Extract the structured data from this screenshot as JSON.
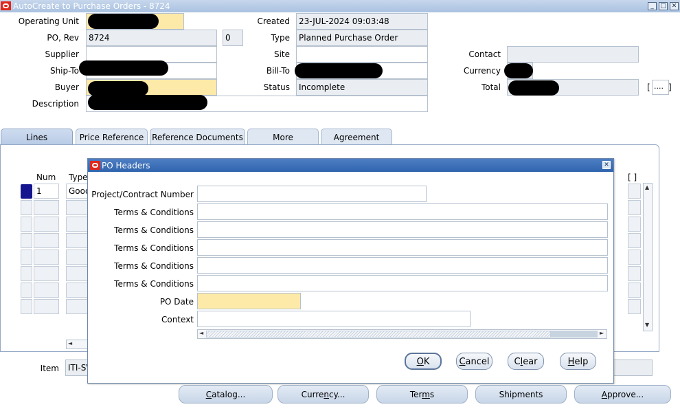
{
  "window": {
    "title": "AutoCreate to Purchase Orders - 8724",
    "minimize": "_",
    "maximize": "□",
    "close": "✕"
  },
  "header": {
    "operating_unit_label": "Operating Unit",
    "po_rev_label": "PO, Rev",
    "po_number": "8724",
    "revision": "0",
    "supplier_label": "Supplier",
    "ship_to_label": "Ship-To",
    "buyer_label": "Buyer",
    "description_label": "Description",
    "created_label": "Created",
    "created_value": "23-JUL-2024 09:03:48",
    "type_label": "Type",
    "type_value": "Planned Purchase Order",
    "site_label": "Site",
    "bill_to_label": "Bill-To",
    "status_label": "Status",
    "status_value": "Incomplete",
    "contact_label": "Contact",
    "currency_label": "Currency",
    "total_label": "Total",
    "flex_open": "[",
    "flex_dots": "....",
    "flex_close": "]"
  },
  "tabs": [
    {
      "label": "Lines"
    },
    {
      "label": "Price Reference"
    },
    {
      "label": "Reference Documents"
    },
    {
      "label": "More"
    },
    {
      "label": "Agreement"
    }
  ],
  "lines": {
    "num_header": "Num",
    "type_header": "Type",
    "row1_num": "1",
    "row1_type": "Good",
    "flex_header": "[ ]",
    "scroll_up": "▲",
    "scroll_down": "▼",
    "scroll_left": "◄"
  },
  "item": {
    "label": "Item",
    "value": "ITI-SV"
  },
  "dialog": {
    "title": "PO Headers",
    "close": "✕",
    "project_label": "Project/Contract Number",
    "tc1_label": "Terms & Conditions",
    "tc2_label": "Terms & Conditions",
    "tc3_label": "Terms & Conditions",
    "tc4_label": "Terms & Conditions",
    "tc5_label": "Terms & Conditions",
    "po_date_label": "PO Date",
    "context_label": "Context",
    "scroll_left": "◄",
    "scroll_right": "►",
    "ok": {
      "accel": "O",
      "rest": "K"
    },
    "cancel": {
      "accel": "C",
      "rest": "ancel"
    },
    "clear": {
      "pre": "C",
      "accel": "l",
      "rest": "ear"
    },
    "help": {
      "accel": "H",
      "rest": "elp"
    }
  },
  "bottom_buttons": {
    "catalog": {
      "accel": "C",
      "rest": "atalog..."
    },
    "currency": {
      "pre": "Curre",
      "accel": "n",
      "rest": "cy..."
    },
    "terms": {
      "pre": "Ter",
      "accel": "m",
      "rest": "s"
    },
    "shipments": "Shipments",
    "approve": {
      "accel": "A",
      "rest": "pprove..."
    }
  },
  "colors": {
    "required_field": "#fdeaa8",
    "readonly_field": "#eaeef2",
    "dialog_title": "#2f64ad",
    "oracle_red": "#e0281c"
  }
}
